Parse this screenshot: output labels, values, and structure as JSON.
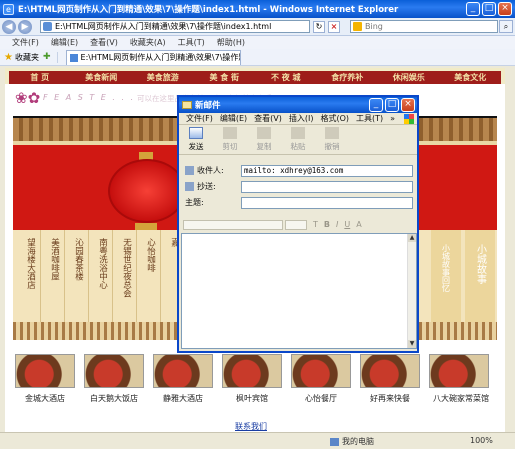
{
  "ie": {
    "title": "E:\\HTML网页制作从入门到精通\\效果\\7\\操作题\\index1.html - Windows Internet Explorer",
    "address": "E:\\HTML网页制作从入门到精通\\效果\\7\\操作题\\index1.html",
    "search_placeholder": "Bing",
    "menu": [
      "文件(F)",
      "编辑(E)",
      "查看(V)",
      "收藏夹(A)",
      "工具(T)",
      "帮助(H)"
    ],
    "favorites_label": "收藏夹",
    "tab_title": "E:\\HTML网页制作从入门到精通\\效果\\7\\操作题..."
  },
  "page": {
    "nav": [
      "首  页",
      "美食新闻",
      "美食旅游",
      "美 食 街",
      "不 夜 城",
      "食疗养补",
      "休闲娱乐",
      "美食文化"
    ],
    "logo_text": "F E A S T E . . .",
    "logo_faded": "可以在这里品尝各地风味、方便美食享受",
    "panels": [
      "望海楼大酒店",
      "美酒咖啡屋",
      "沁园春茶楼",
      "南粤洗浴中心",
      "无锡世纪夜总会",
      "心怡咖啡",
      "嘉"
    ],
    "right_panels": [
      "小城故事回忆",
      "小城故事"
    ],
    "restaurants": [
      "金城大酒店",
      "白天鹅大饭店",
      "静雅大酒店",
      "枫叶宾馆",
      "心怡餐厅",
      "好再来快餐",
      "八大碗家常菜馆"
    ],
    "contact": "联系我们"
  },
  "mail": {
    "title": "新邮件",
    "menu": [
      "文件(F)",
      "编辑(E)",
      "查看(V)",
      "插入(I)",
      "格式(O)",
      "工具(T)",
      "»"
    ],
    "toolbar": [
      "发送",
      "剪切",
      "复制",
      "粘贴",
      "撤销"
    ],
    "to_label": "收件人:",
    "to_value": "mailto: xdhrey@163.com",
    "cc_label": "抄送:",
    "subject_label": "主题:"
  },
  "status": {
    "zone": "我的电脑",
    "zoom": "100%"
  }
}
